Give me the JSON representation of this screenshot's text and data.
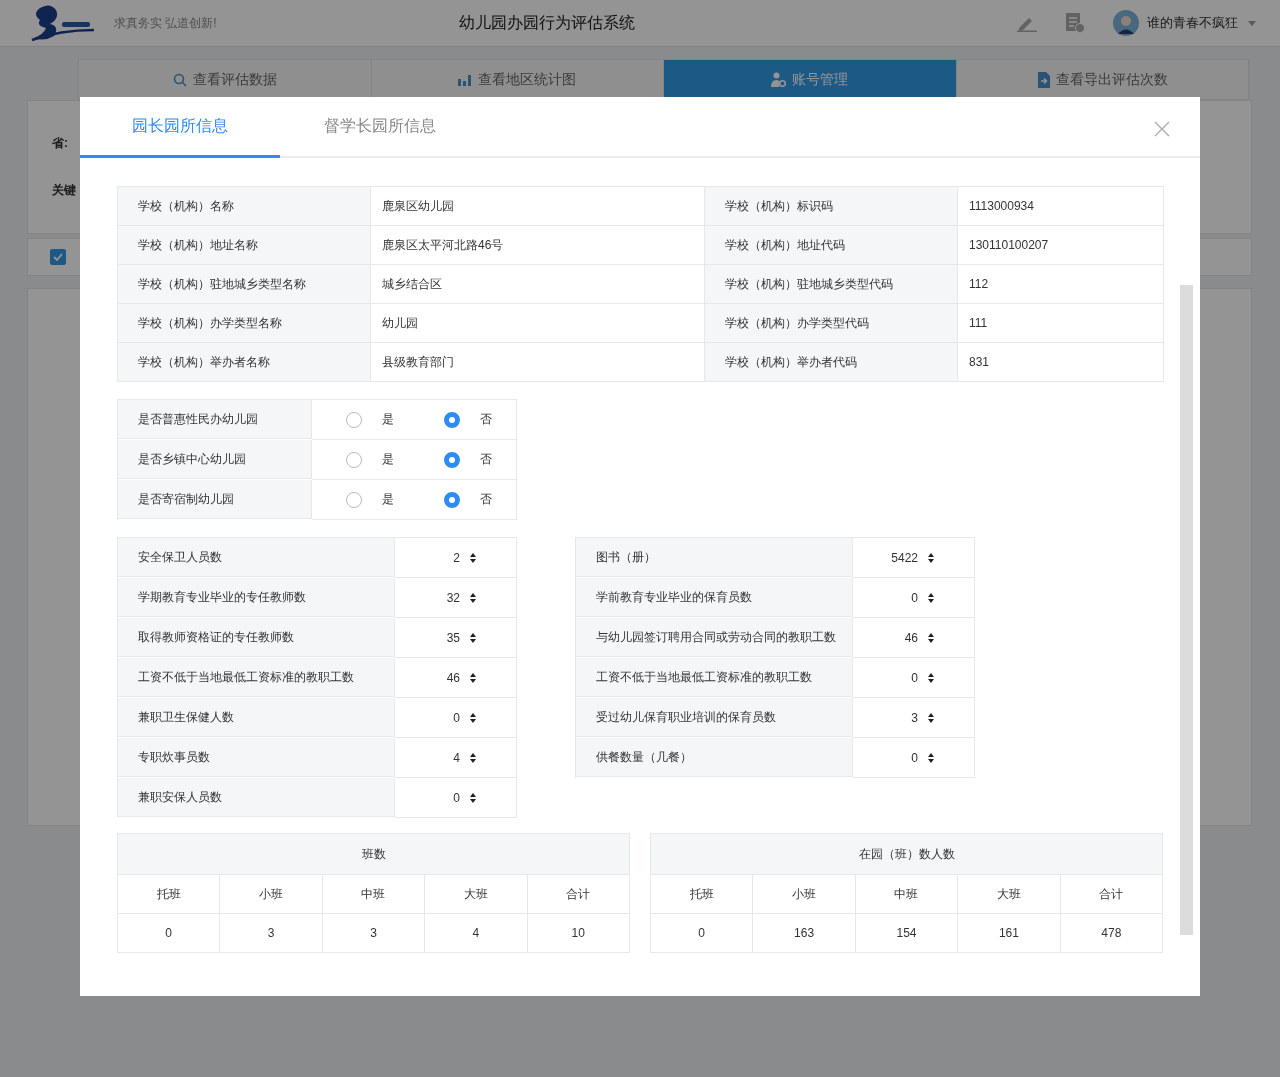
{
  "header": {
    "tagline": "求真务实 弘道创新!",
    "title": "幼儿园办园行为评估系统",
    "user_name": "谁的青春不疯狂"
  },
  "nav_tabs": [
    {
      "label": "查看评估数据",
      "selected": false
    },
    {
      "label": "查看地区统计图",
      "selected": false
    },
    {
      "label": "账号管理",
      "selected": true
    },
    {
      "label": "查看导出评估次数",
      "selected": false
    }
  ],
  "filter": {
    "province_label": "省:",
    "keyword_label": "关键",
    "checkbox": {
      "checked": true
    }
  },
  "modal": {
    "tabs": [
      {
        "label": "园长园所信息",
        "selected": true
      },
      {
        "label": "督学长园所信息",
        "selected": false
      }
    ],
    "info_rows": [
      [
        "学校（机构）名称",
        "鹿泉区幼儿园",
        "学校（机构）标识码",
        "1113000934"
      ],
      [
        "学校（机构）地址名称",
        "鹿泉区太平河北路46号",
        "学校（机构）地址代码",
        "130110100207"
      ],
      [
        "学校（机构）驻地城乡类型名称",
        "城乡结合区",
        "学校（机构）驻地城乡类型代码",
        "112"
      ],
      [
        "学校（机构）办学类型名称",
        "幼儿园",
        "学校（机构）办学类型代码",
        "111"
      ],
      [
        "学校（机构）举办者名称",
        "县级教育部门",
        "学校（机构）举办者代码",
        "831"
      ]
    ],
    "yes_no": [
      {
        "label": "是否普惠性民办幼儿园",
        "options": [
          {
            "label": "是",
            "selected": false
          },
          {
            "label": "否",
            "selected": true
          }
        ]
      },
      {
        "label": "是否乡镇中心幼儿园",
        "options": [
          {
            "label": "是",
            "selected": false
          },
          {
            "label": "否",
            "selected": true
          }
        ]
      },
      {
        "label": "是否寄宿制幼儿园",
        "options": [
          {
            "label": "是",
            "selected": false
          },
          {
            "label": "否",
            "selected": true
          }
        ]
      }
    ],
    "counts_left": [
      {
        "label": "安全保卫人员数",
        "value": "2"
      },
      {
        "label": "学期教育专业毕业的专任教师数",
        "value": "32"
      },
      {
        "label": "取得教师资格证的专任教师数",
        "value": "35"
      },
      {
        "label": "工资不低于当地最低工资标准的教职工数",
        "value": "46"
      },
      {
        "label": "兼职卫生保健人数",
        "value": "0"
      },
      {
        "label": "专职炊事员数",
        "value": "4"
      },
      {
        "label": "兼职安保人员数",
        "value": "0"
      }
    ],
    "counts_right": [
      {
        "label": "图书（册）",
        "value": "5422"
      },
      {
        "label": "学前教育专业毕业的保育员数",
        "value": "0"
      },
      {
        "label": "与幼儿园签订聘用合同或劳动合同的教职工数",
        "value": "46"
      },
      {
        "label": "工资不低于当地最低工资标准的教职工数",
        "value": "0"
      },
      {
        "label": "受过幼儿保育职业培训的保育员数",
        "value": "3"
      },
      {
        "label": "供餐数量（几餐）",
        "value": "0"
      }
    ],
    "class_tables": [
      {
        "title": "班数",
        "columns": [
          "托班",
          "小班",
          "中班",
          "大班",
          "合计"
        ],
        "values": [
          "0",
          "3",
          "3",
          "4",
          "10"
        ]
      },
      {
        "title": "在园（班）数人数",
        "columns": [
          "托班",
          "小班",
          "中班",
          "大班",
          "合计"
        ],
        "values": [
          "0",
          "163",
          "154",
          "161",
          "478"
        ]
      }
    ]
  }
}
